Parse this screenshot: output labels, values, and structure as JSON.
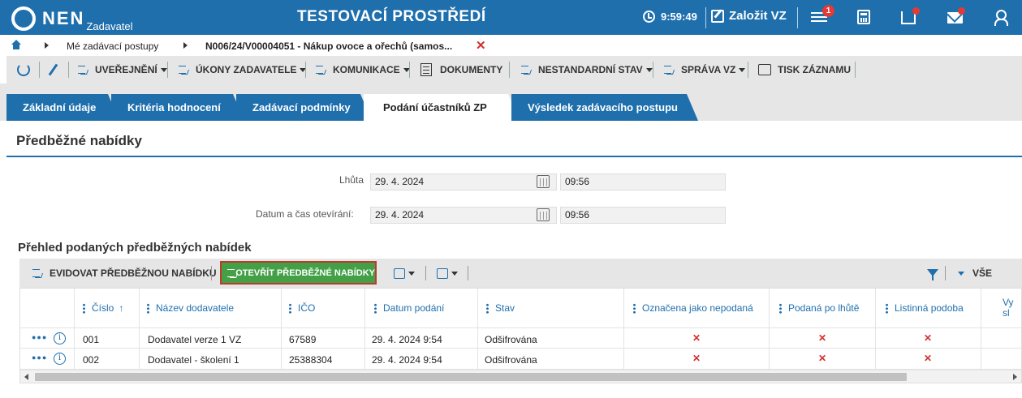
{
  "header": {
    "logo": "NEN",
    "logo_sub": "Zadavatel",
    "environment": "TESTOVACÍ PROSTŘEDÍ",
    "time": "9:59:49",
    "create_vz": "Založit VZ",
    "notification_count": "1"
  },
  "breadcrumb": {
    "item1": "Mé zadávací postupy",
    "item2": "N006/24/V00004051 - Nákup ovoce a ořechů (samos..."
  },
  "toolbar": {
    "publish": "UVEŘEJNĚNÍ",
    "actions": "ÚKONY ZADAVATELE",
    "communication": "KOMUNIKACE",
    "documents": "DOKUMENTY",
    "nonstandard": "NESTANDARDNÍ STAV",
    "management": "SPRÁVA VZ",
    "print": "TISK ZÁZNAMU"
  },
  "tabs": [
    {
      "label": "Základní údaje"
    },
    {
      "label": "Kritéria hodnocení"
    },
    {
      "label": "Zadávací podmínky"
    },
    {
      "label": "Podání účastníků ZP"
    },
    {
      "label": "Výsledek zadávacího postupu"
    }
  ],
  "section": {
    "title": "Předběžné nabídky",
    "deadline_label": "Lhůta",
    "deadline_date": "29. 4. 2024",
    "deadline_time": "09:56",
    "opening_label": "Datum a čas otevírání:",
    "opening_date": "29. 4. 2024",
    "opening_time": "09:56",
    "overview_title": "Přehled podaných předběžných nabídek"
  },
  "grid_toolbar": {
    "register": "EVIDOVAT PŘEDBĚŽNOU NABÍDKU",
    "open": "OTEVŘÍT PŘEDBĚŽNÉ NABÍDKY",
    "all": "VŠE"
  },
  "grid": {
    "columns": [
      "Číslo",
      "Název dodavatele",
      "IČO",
      "Datum podání",
      "Stav",
      "Označena jako nepodaná",
      "Podaná po lhůtě",
      "Listinná podoba",
      "Vy",
      "sl"
    ],
    "rows": [
      {
        "number": "001",
        "supplier": "Dodavatel verze 1 VZ",
        "ico": "67589",
        "date": "29. 4. 2024 9:54",
        "status": "Odšifrována",
        "x": "✕"
      },
      {
        "number": "002",
        "supplier": "Dodavatel - školení 1",
        "ico": "25388304",
        "date": "29. 4. 2024 9:54",
        "status": "Odšifrována",
        "x": "✕"
      }
    ]
  },
  "colors": {
    "brand": "#1f6fad",
    "action_green": "#43a047",
    "error_red": "#d32f2f"
  }
}
